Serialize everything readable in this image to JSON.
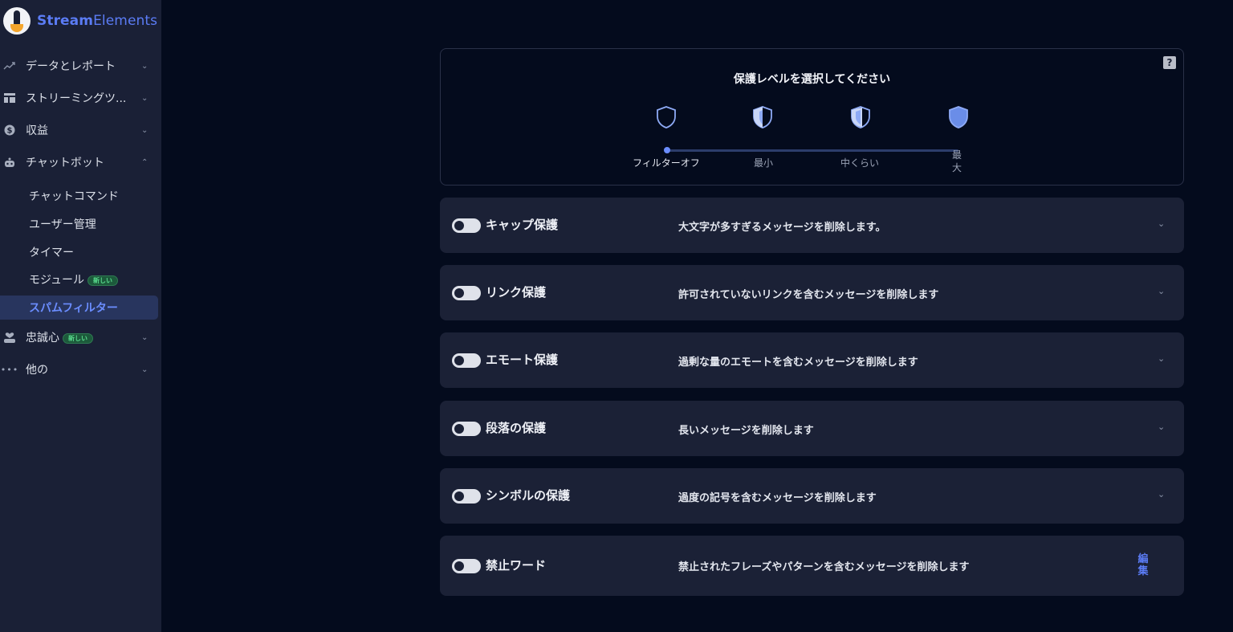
{
  "brand": {
    "name_bold": "Stream",
    "name_rest": "Elements"
  },
  "sidebar": {
    "items": [
      {
        "label": "データとレポート",
        "icon": "trending-up-icon"
      },
      {
        "label": "ストリーミングツ...",
        "icon": "dashboard-icon"
      },
      {
        "label": "収益",
        "icon": "dollar-icon"
      },
      {
        "label": "チャットボット",
        "icon": "robot-icon"
      }
    ],
    "chatbot_sub": [
      {
        "label": "チャットコマンド"
      },
      {
        "label": "ユーザー管理"
      },
      {
        "label": "タイマー"
      },
      {
        "label": "モジュール",
        "badge": "新しい"
      },
      {
        "label": "スパムフィルター",
        "active": true
      }
    ],
    "items2": [
      {
        "label": "忠誠心",
        "badge": "新しい",
        "icon": "loyalty-icon"
      },
      {
        "label": "他の",
        "icon": "more-icon"
      }
    ]
  },
  "protection": {
    "title": "保護レベルを選択してください",
    "help": "?",
    "levels": [
      {
        "label": "フィルターオフ"
      },
      {
        "label": "最小"
      },
      {
        "label": "中くらい"
      },
      {
        "label": "最大"
      }
    ],
    "selected_level": "フィルターオフ"
  },
  "rules": [
    {
      "name": "キャップ保護",
      "desc": "大文字が多すぎるメッセージを削除します。",
      "enabled": false
    },
    {
      "name": "リンク保護",
      "desc": "許可されていないリンクを含むメッセージを削除します",
      "enabled": false
    },
    {
      "name": "エモート保護",
      "desc": "過剰な量のエモートを含むメッセージを削除します",
      "enabled": false
    },
    {
      "name": "段落の保護",
      "desc": "長いメッセージを削除します",
      "enabled": false
    },
    {
      "name": "シンボルの保護",
      "desc": "過度の記号を含むメッセージを削除します",
      "enabled": false
    },
    {
      "name": "禁止ワード",
      "desc": "禁止されたフレーズやパターンを含むメッセージを削除します",
      "enabled": false,
      "action": "編集"
    }
  ],
  "colors": {
    "accent": "#5b7cf5",
    "sidebar_bg": "#1a2036",
    "page_bg": "#040b1d",
    "card_bg": "#1b2136"
  }
}
